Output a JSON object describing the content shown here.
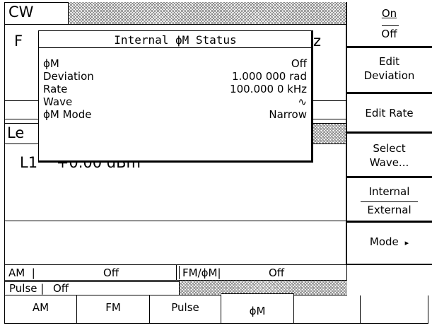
{
  "header": {
    "mode_label": "CW"
  },
  "frequency_area": {
    "label_fragment": "F",
    "right_fragment": "z"
  },
  "level_area": {
    "label_fragment": "Le",
    "value_line": "L1    +0.00 dBm"
  },
  "status_row1": {
    "am_label": "AM  |",
    "am_value": "Off",
    "fm_label": "FM/ϕM|",
    "fm_value": "Off"
  },
  "status_row2": {
    "pulse_label": "Pulse |",
    "pulse_value": "Off"
  },
  "popup": {
    "title": "Internal ϕM Status",
    "rows": [
      {
        "label": "ϕM",
        "value": "Off"
      },
      {
        "label": "Deviation",
        "value": "1.000 000 rad"
      },
      {
        "label": "Rate",
        "value": "100.000 0 kHz"
      },
      {
        "label": "Wave",
        "value": "∿"
      },
      {
        "label": "ϕM Mode",
        "value": "Narrow"
      }
    ]
  },
  "softkeys": {
    "on_off": {
      "top": "On",
      "bottom": "Off"
    },
    "edit_deviation": {
      "line1": "Edit",
      "line2": "Deviation"
    },
    "edit_rate": {
      "line1": "Edit Rate"
    },
    "select_wave": {
      "line1": "Select",
      "line2": "Wave..."
    },
    "internal_external": {
      "top": "Internal",
      "bottom": "External"
    },
    "mode": {
      "line1": "Mode",
      "arrow": "▸"
    }
  },
  "tabs": [
    "AM",
    "FM",
    "Pulse",
    "ϕM",
    "",
    ""
  ]
}
